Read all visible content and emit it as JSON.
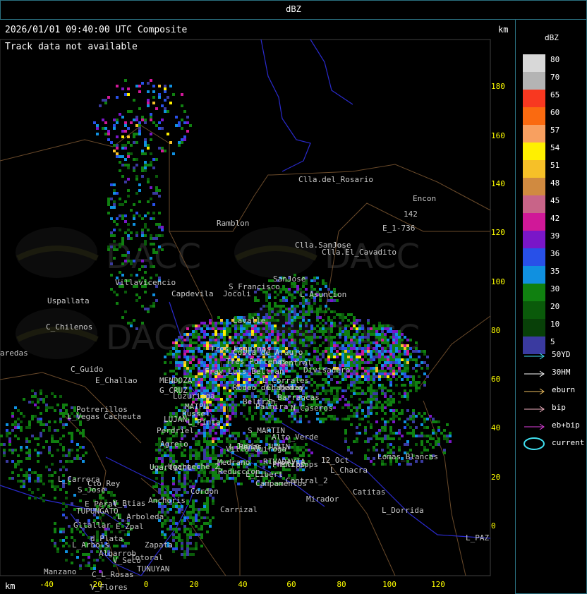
{
  "header": {
    "title": "dBZ",
    "timestamp": "2026/01/01 09:40:00 UTC Composite",
    "track_status": "Track data not available",
    "km_label": "km"
  },
  "axes": {
    "x_ticks": [
      "-40",
      "-20",
      "0",
      "20",
      "40",
      "60",
      "80",
      "100",
      "120"
    ],
    "y_ticks": [
      "180",
      "160",
      "140",
      "120",
      "100",
      "80",
      "60",
      "40",
      "20",
      "0"
    ],
    "tick_color": "#ffff00"
  },
  "legend": {
    "title": "dBZ",
    "entries": [
      {
        "label": "80",
        "color": "#d8d8d8"
      },
      {
        "label": "70",
        "color": "#b4b4b4"
      },
      {
        "label": "65",
        "color": "#f83820"
      },
      {
        "label": "60",
        "color": "#fa6a10"
      },
      {
        "label": "57",
        "color": "#f8a060"
      },
      {
        "label": "54",
        "color": "#fff000"
      },
      {
        "label": "51",
        "color": "#f6c028"
      },
      {
        "label": "48",
        "color": "#d08a40"
      },
      {
        "label": "45",
        "color": "#c86488"
      },
      {
        "label": "42",
        "color": "#d01898"
      },
      {
        "label": "39",
        "color": "#7a16c8"
      },
      {
        "label": "36",
        "color": "#2850e8"
      },
      {
        "label": "35",
        "color": "#1090e0"
      },
      {
        "label": "30",
        "color": "#108010"
      },
      {
        "label": "20",
        "color": "#0a5a0a"
      },
      {
        "label": "10",
        "color": "#084008"
      },
      {
        "label": "5",
        "color": "#3a3aa0"
      }
    ],
    "tracks": [
      {
        "label": "50YD",
        "color": "#40e0f0",
        "icon": "arrow-right-icon"
      },
      {
        "label": "30HM",
        "color": "#ffffff",
        "icon": "arrow-right-icon"
      },
      {
        "label": "eburn",
        "color": "#f0c060",
        "icon": "arrow-right-icon"
      },
      {
        "label": "bip",
        "color": "#f0b0c0",
        "icon": "arrow-right-icon"
      },
      {
        "label": "eb+bip",
        "color": "#e040e0",
        "icon": "arrow-right-icon"
      },
      {
        "label": "current",
        "color": "#40e0f0",
        "icon": "ellipse-icon"
      }
    ]
  },
  "watermarks": [
    "DACC",
    "DACC",
    "DACC",
    "DACC"
  ],
  "place_labels": [
    {
      "name": "Clla.del_Rosario"
    },
    {
      "name": "Encon"
    },
    {
      "name": "142"
    },
    {
      "name": "E_1-736"
    },
    {
      "name": "Ramblon"
    },
    {
      "name": "Clla.SanJose"
    },
    {
      "name": "Clla.El_Cavadito"
    },
    {
      "name": "Villavicencio"
    },
    {
      "name": "Capdevila"
    },
    {
      "name": "S_Francisco"
    },
    {
      "name": "SanJose"
    },
    {
      "name": "L_Asuncion"
    },
    {
      "name": "Jocoli"
    },
    {
      "name": "Uspallata"
    },
    {
      "name": "C_Chilenos"
    },
    {
      "name": "aredas"
    },
    {
      "name": "C_Guido"
    },
    {
      "name": "E_Challao"
    },
    {
      "name": "MENDOZA"
    },
    {
      "name": "G_CRUZ"
    },
    {
      "name": "Luzuriaga"
    },
    {
      "name": "MAIPU"
    },
    {
      "name": "Russel"
    },
    {
      "name": "LUJAN"
    },
    {
      "name": "L_Pinta"
    },
    {
      "name": "Perdriel"
    },
    {
      "name": "Potrerillos"
    },
    {
      "name": "Cacheuta"
    },
    {
      "name": "L_Vegas"
    },
    {
      "name": "Agrelo"
    },
    {
      "name": "Lavalle"
    },
    {
      "name": "Costa_de_Araujo"
    },
    {
      "name": "Tres_Porteñas"
    },
    {
      "name": "Fray_Luis_Beltran"
    },
    {
      "name": "Rodeo_del_Medio"
    },
    {
      "name": "L_Corrales"
    },
    {
      "name": "Ugarteche"
    },
    {
      "name": "Tres_Esquinas"
    },
    {
      "name": "Central"
    },
    {
      "name": "Divisadero"
    },
    {
      "name": "Philipps"
    },
    {
      "name": "Beltran"
    },
    {
      "name": "L_Barrancas"
    },
    {
      "name": "Chapanay"
    },
    {
      "name": "Palmira"
    },
    {
      "name": "N_Caseros"
    },
    {
      "name": "S_MARTIN"
    },
    {
      "name": "Alto_Verde"
    },
    {
      "name": "Villa_Quiroga"
    },
    {
      "name": "Junin"
    },
    {
      "name": "Medrano"
    },
    {
      "name": "Reduccion"
    },
    {
      "name": "RIVADAVIA"
    },
    {
      "name": "L_Peñas_JUNIN"
    },
    {
      "name": "Philips"
    },
    {
      "name": "12_Oct"
    },
    {
      "name": "L_Libert"
    },
    {
      "name": "Campamentos"
    },
    {
      "name": "Central_2"
    },
    {
      "name": "Mirador"
    },
    {
      "name": "L_Chacra"
    },
    {
      "name": "Catitas"
    },
    {
      "name": "Lomas_Blancas"
    },
    {
      "name": "L_Dorrida"
    },
    {
      "name": "L_PAZ"
    },
    {
      "name": "Ugarteche_2"
    },
    {
      "name": "L_Carrera"
    },
    {
      "name": "Cto_Rey"
    },
    {
      "name": "S_Jose"
    },
    {
      "name": "V_Btias"
    },
    {
      "name": "Anchoris"
    },
    {
      "name": "E_Peral"
    },
    {
      "name": "TUPUNGATO"
    },
    {
      "name": "L_Arboleda"
    },
    {
      "name": "Gltallar"
    },
    {
      "name": "E_Zpal"
    },
    {
      "name": "d_Plata"
    },
    {
      "name": "L_Arbols"
    },
    {
      "name": "Zapata"
    },
    {
      "name": "Algarrob"
    },
    {
      "name": "V_Seco"
    },
    {
      "name": "Totoral"
    },
    {
      "name": "TUNUYAN"
    },
    {
      "name": "Manzano"
    },
    {
      "name": "C_L_Rosas"
    },
    {
      "name": "V_Flores"
    },
    {
      "name": "Cordon"
    },
    {
      "name": "Carrizal"
    }
  ]
}
